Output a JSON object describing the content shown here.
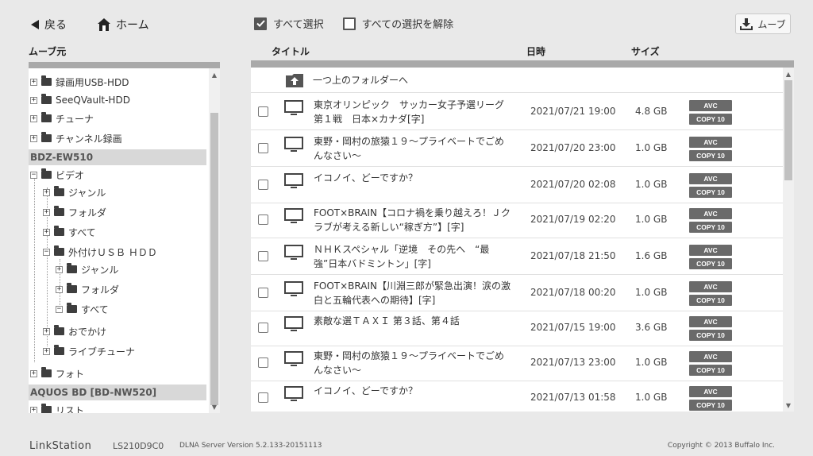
{
  "nav": {
    "back_label": "戻る",
    "home_label": "ホーム"
  },
  "selection": {
    "select_all": "すべて選択",
    "deselect_all": "すべての選択を解除",
    "select_all_checked": true
  },
  "move_button": "ムーブ",
  "left": {
    "header": "ムーブ元",
    "tree": [
      {
        "label": "録画用USB-HDD",
        "expanded": false
      },
      {
        "label": "SeeQVault-HDD",
        "expanded": false
      },
      {
        "label": "チューナ",
        "expanded": false
      },
      {
        "label": "チャンネル録画",
        "expanded": false
      },
      {
        "device": "BDZ-EW510"
      },
      {
        "label": "ビデオ",
        "expanded": true
      },
      {
        "label": "ジャンル",
        "expanded": false
      },
      {
        "label": "フォルダ",
        "expanded": false
      },
      {
        "label": "すべて",
        "expanded": false
      },
      {
        "label": "外付けＵＳＢ ＨＤＤ",
        "expanded": true
      },
      {
        "label": "ジャンル",
        "expanded": false
      },
      {
        "label": "フォルダ",
        "expanded": false
      },
      {
        "label": "すべて",
        "expanded": true
      },
      {
        "label": "おでかけ",
        "expanded": false
      },
      {
        "label": "ライブチューナ",
        "expanded": false
      },
      {
        "label": "フォト",
        "expanded": false
      },
      {
        "device": "AQUOS BD [BD-NW520]"
      },
      {
        "label": "リスト",
        "expanded": false
      }
    ]
  },
  "columns": {
    "title": "タイトル",
    "date": "日時",
    "size": "サイズ"
  },
  "up_folder": "一つ上のフォルダーへ",
  "rows": [
    {
      "title": "東京オリンピック　サッカー女子予選リーグ　第１戦　日本×カナダ[字]",
      "date": "2021/07/21 19:00",
      "size": "4.8 GB",
      "codec": "AVC",
      "copy": "COPY 10"
    },
    {
      "title": "東野・岡村の旅猿１９～プライベートでごめんなさい～",
      "date": "2021/07/20 23:00",
      "size": "1.0 GB",
      "codec": "AVC",
      "copy": "COPY 10"
    },
    {
      "title": "イコノイ、どーですか？",
      "date": "2021/07/20 02:08",
      "size": "1.0 GB",
      "codec": "AVC",
      "copy": "COPY 10"
    },
    {
      "title": "FOOT×BRAIN【コロナ禍を乗り越えろ！Ｊクラブが考える新しい“稼ぎ方”】[字]",
      "date": "2021/07/19 02:20",
      "size": "1.0 GB",
      "codec": "AVC",
      "copy": "COPY 10"
    },
    {
      "title": "ＮＨＫスペシャル「逆境　その先へ　“最強”日本バドミントン」[字]",
      "date": "2021/07/18 21:50",
      "size": "1.6 GB",
      "codec": "AVC",
      "copy": "COPY 10"
    },
    {
      "title": "FOOT×BRAIN【川淵三郎が緊急出演！涙の激白と五輪代表への期待】[字]",
      "date": "2021/07/18 00:20",
      "size": "1.0 GB",
      "codec": "AVC",
      "copy": "COPY 10"
    },
    {
      "title": "素敵な選ＴＡＸＩ 第３話、第４話",
      "date": "2021/07/15 19:00",
      "size": "3.6 GB",
      "codec": "AVC",
      "copy": "COPY 10"
    },
    {
      "title": "東野・岡村の旅猿１９～プライベートでごめんなさい～",
      "date": "2021/07/13 23:00",
      "size": "1.0 GB",
      "codec": "AVC",
      "copy": "COPY 10"
    },
    {
      "title": "イコノイ、どーですか？",
      "date": "2021/07/13 01:58",
      "size": "1.0 GB",
      "codec": "AVC",
      "copy": "COPY 10"
    }
  ],
  "footer": {
    "brand": "LinkStation",
    "model": "LS210D9C0",
    "server": "DLNA Server Version 5.2.133-20151113",
    "copyright": "Copyright © 2013 Buffalo Inc."
  },
  "colors": {
    "panel_header": "#a9a9a9",
    "badge": "#6a6a6a",
    "device_header": "#d8d8d8"
  },
  "icons": [
    "back-arrow-icon",
    "home-icon",
    "download-icon",
    "folder-icon",
    "up-folder-icon",
    "tv-icon"
  ]
}
